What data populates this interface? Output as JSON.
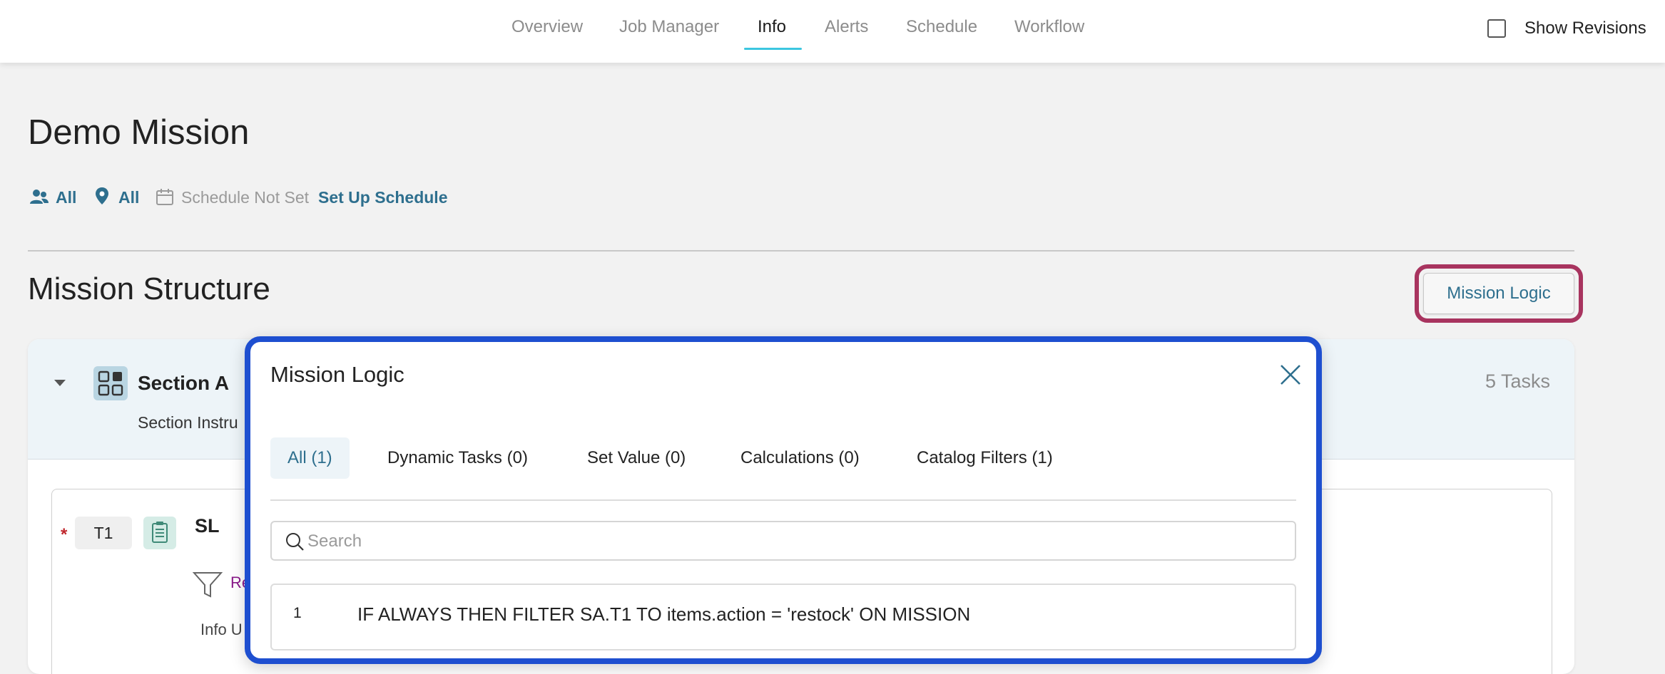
{
  "nav": {
    "tabs": [
      {
        "label": "Overview"
      },
      {
        "label": "Job Manager"
      },
      {
        "label": "Info"
      },
      {
        "label": "Alerts"
      },
      {
        "label": "Schedule"
      },
      {
        "label": "Workflow"
      }
    ],
    "active_tab": "Info",
    "show_revisions_label": "Show Revisions",
    "show_revisions_checked": false
  },
  "mission": {
    "title": "Demo Mission",
    "users_label": "All",
    "locations_label": "All",
    "schedule_status": "Schedule Not Set",
    "schedule_link": "Set Up Schedule"
  },
  "structure": {
    "heading": "Mission Structure",
    "mission_logic_button": "Mission Logic",
    "section": {
      "name": "Section A",
      "instructions": "Section Instru",
      "tasks_count": "5 Tasks",
      "task": {
        "id": "T1",
        "name": "SL",
        "filter_text": "Re",
        "info_text": "Info U"
      }
    }
  },
  "modal": {
    "title": "Mission Logic",
    "tabs": [
      {
        "label": "All (1)"
      },
      {
        "label": "Dynamic Tasks (0)"
      },
      {
        "label": "Set Value (0)"
      },
      {
        "label": "Calculations (0)"
      },
      {
        "label": "Catalog Filters (1)"
      }
    ],
    "active_tab": "All (1)",
    "search_placeholder": "Search",
    "rules": [
      {
        "number": "1",
        "text": "IF ALWAYS THEN FILTER SA.T1 TO items.action = 'restock' ON MISSION"
      }
    ]
  },
  "colors": {
    "accent_blue": "#2e6f8e",
    "tab_underline": "#3cc6e0",
    "highlight_pink": "#a8345f",
    "highlight_blue": "#1e4fd0",
    "required_red": "#c0272d",
    "filter_purple": "#8a1a8a"
  },
  "icons": [
    "users-icon",
    "location-pin-icon",
    "calendar-icon",
    "section-grid-icon",
    "checklist-icon",
    "filter-icon",
    "close-icon",
    "search-icon"
  ]
}
